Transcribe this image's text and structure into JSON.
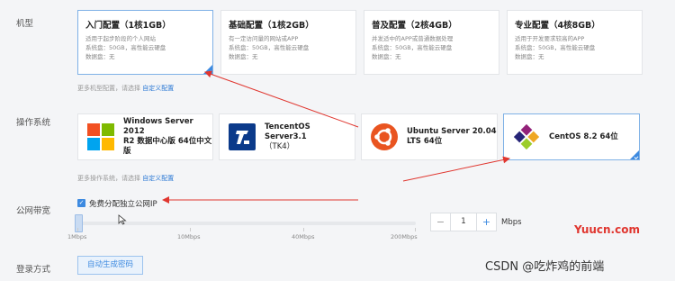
{
  "labels": {
    "model": "机型",
    "os": "操作系统",
    "bandwidth": "公网带宽",
    "login": "登录方式"
  },
  "models": [
    {
      "title": "入门配置（1核1GB）",
      "desc": "适用于起步阶段的个人网站",
      "sys": "系统盘：50GB，高性能云硬盘",
      "data": "数据盘：无",
      "selected": true
    },
    {
      "title": "基础配置（1核2GB）",
      "desc": "有一定访问量的网站或APP",
      "sys": "系统盘：50GB，高性能云硬盘",
      "data": "数据盘：无",
      "selected": false
    },
    {
      "title": "普及配置（2核4GB）",
      "desc": "并发适中的APP或普通数据处理",
      "sys": "系统盘：50GB，高性能云硬盘",
      "data": "数据盘：无",
      "selected": false
    },
    {
      "title": "专业配置（4核8GB）",
      "desc": "适用于开发要求较高的APP",
      "sys": "系统盘：50GB，高性能云硬盘",
      "data": "数据盘：无",
      "selected": false
    }
  ],
  "model_hint": {
    "text": "更多机型配置，请选择",
    "link": "自定义配置"
  },
  "os_cards": [
    {
      "name_line1": "Windows Server 2012",
      "name_line2": "R2 数据中心版 64位中文",
      "name_line3": "版",
      "logo": "windows-logo",
      "selected": false
    },
    {
      "name_line1": "TencentOS Server3.1",
      "name_line2": "（TK4）",
      "name_line3": "",
      "logo": "tencentos-logo",
      "selected": false
    },
    {
      "name_line1": "Ubuntu Server 20.04",
      "name_line2": "LTS 64位",
      "name_line3": "",
      "logo": "ubuntu-logo",
      "selected": false
    },
    {
      "name_line1": "CentOS 8.2 64位",
      "name_line2": "",
      "name_line3": "",
      "logo": "centos-logo",
      "selected": true
    }
  ],
  "os_hint": {
    "text": "更多操作系统，请选择",
    "link": "自定义配置"
  },
  "bandwidth": {
    "checkbox_label": "免费分配独立公网IP",
    "checked": true,
    "ticks": [
      "1Mbps",
      "10Mbps",
      "40Mbps",
      "200Mbps"
    ],
    "value": "1",
    "unit": "Mbps",
    "minus": "−",
    "plus": "+"
  },
  "login": {
    "button": "自动生成密码"
  },
  "watermarks": {
    "site": "Yuucn.com",
    "author": "CSDN @吃炸鸡的前端"
  },
  "colors": {
    "accent": "#3d8ae0",
    "annotation": "#e0362f"
  }
}
